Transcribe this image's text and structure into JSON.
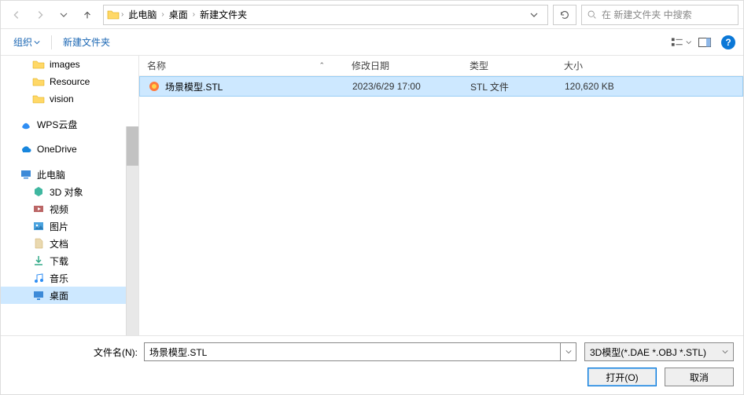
{
  "nav": {
    "breadcrumbs": [
      "此电脑",
      "桌面",
      "新建文件夹"
    ],
    "search_placeholder": "在 新建文件夹 中搜索"
  },
  "toolbar": {
    "organize": "组织",
    "new_folder": "新建文件夹"
  },
  "tree": {
    "items": [
      {
        "label": "images",
        "icon": "folder",
        "level": 1
      },
      {
        "label": "Resource",
        "icon": "folder",
        "level": 1
      },
      {
        "label": "vision",
        "icon": "folder",
        "level": 1
      },
      {
        "label": "",
        "spacer": true
      },
      {
        "label": "WPS云盘",
        "icon": "wps",
        "level": 0
      },
      {
        "label": "",
        "spacer": true
      },
      {
        "label": "OneDrive",
        "icon": "onedrive",
        "level": 0
      },
      {
        "label": "",
        "spacer": true
      },
      {
        "label": "此电脑",
        "icon": "thispc",
        "level": 0
      },
      {
        "label": "3D 对象",
        "icon": "3d",
        "level": 1
      },
      {
        "label": "视频",
        "icon": "video",
        "level": 1
      },
      {
        "label": "图片",
        "icon": "picture",
        "level": 1
      },
      {
        "label": "文档",
        "icon": "doc",
        "level": 1
      },
      {
        "label": "下载",
        "icon": "download",
        "level": 1
      },
      {
        "label": "音乐",
        "icon": "music",
        "level": 1
      },
      {
        "label": "桌面",
        "icon": "desktop",
        "level": 1,
        "selected": true
      }
    ]
  },
  "columns": {
    "name": "名称",
    "date": "修改日期",
    "type": "类型",
    "size": "大小"
  },
  "files": [
    {
      "name": "场景模型.STL",
      "date": "2023/6/29 17:00",
      "type": "STL 文件",
      "size": "120,620 KB",
      "selected": true
    }
  ],
  "footer": {
    "filename_label": "文件名(N):",
    "filename_value": "场景模型.STL",
    "filetype_value": "3D模型(*.DAE *.OBJ *.STL)",
    "open_label": "打开(O)",
    "cancel_label": "取消"
  }
}
